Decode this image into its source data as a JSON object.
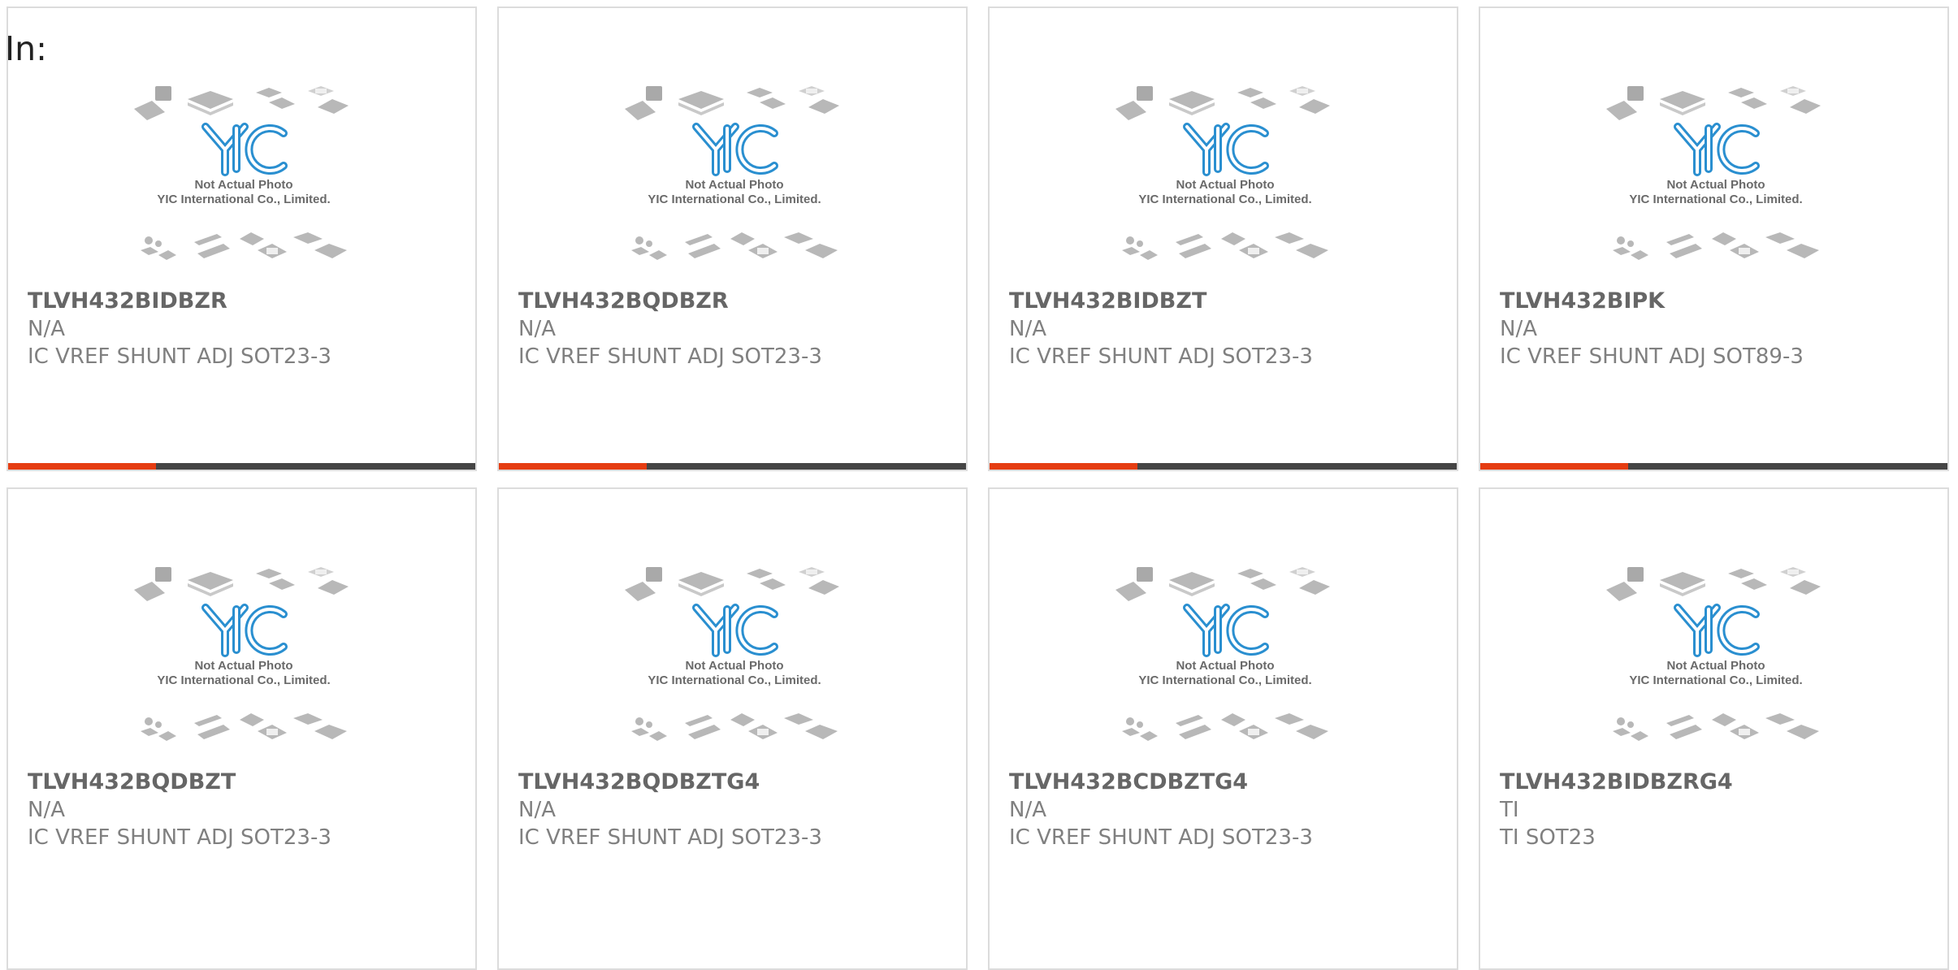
{
  "header": {
    "in_label": "In:"
  },
  "placeholder": {
    "line1": "Not Actual Photo",
    "line2": "YIC International Co., Limited.",
    "logo_text": "YIC"
  },
  "colors": {
    "accent": "#e53d12",
    "bar": "#454545",
    "logo_blue": "#2a8fd0",
    "chip_gray": "#b8b8b8",
    "text_part": "#666666",
    "text_meta": "#808080"
  },
  "products": [
    {
      "part_number": "TLVH432BIDBZR",
      "manufacturer": "N/A",
      "description": "IC VREF SHUNT ADJ SOT23-3"
    },
    {
      "part_number": "TLVH432BQDBZR",
      "manufacturer": "N/A",
      "description": "IC VREF SHUNT ADJ SOT23-3"
    },
    {
      "part_number": "TLVH432BIDBZT",
      "manufacturer": "N/A",
      "description": "IC VREF SHUNT ADJ SOT23-3"
    },
    {
      "part_number": "TLVH432BIPK",
      "manufacturer": "N/A",
      "description": "IC VREF SHUNT ADJ SOT89-3"
    },
    {
      "part_number": "TLVH432BQDBZT",
      "manufacturer": "N/A",
      "description": "IC VREF SHUNT ADJ SOT23-3"
    },
    {
      "part_number": "TLVH432BQDBZTG4",
      "manufacturer": "N/A",
      "description": "IC VREF SHUNT ADJ SOT23-3"
    },
    {
      "part_number": "TLVH432BCDBZTG4",
      "manufacturer": "N/A",
      "description": "IC VREF SHUNT ADJ SOT23-3"
    },
    {
      "part_number": "TLVH432BIDBZRG4",
      "manufacturer": "TI",
      "description": "TI SOT23"
    }
  ]
}
